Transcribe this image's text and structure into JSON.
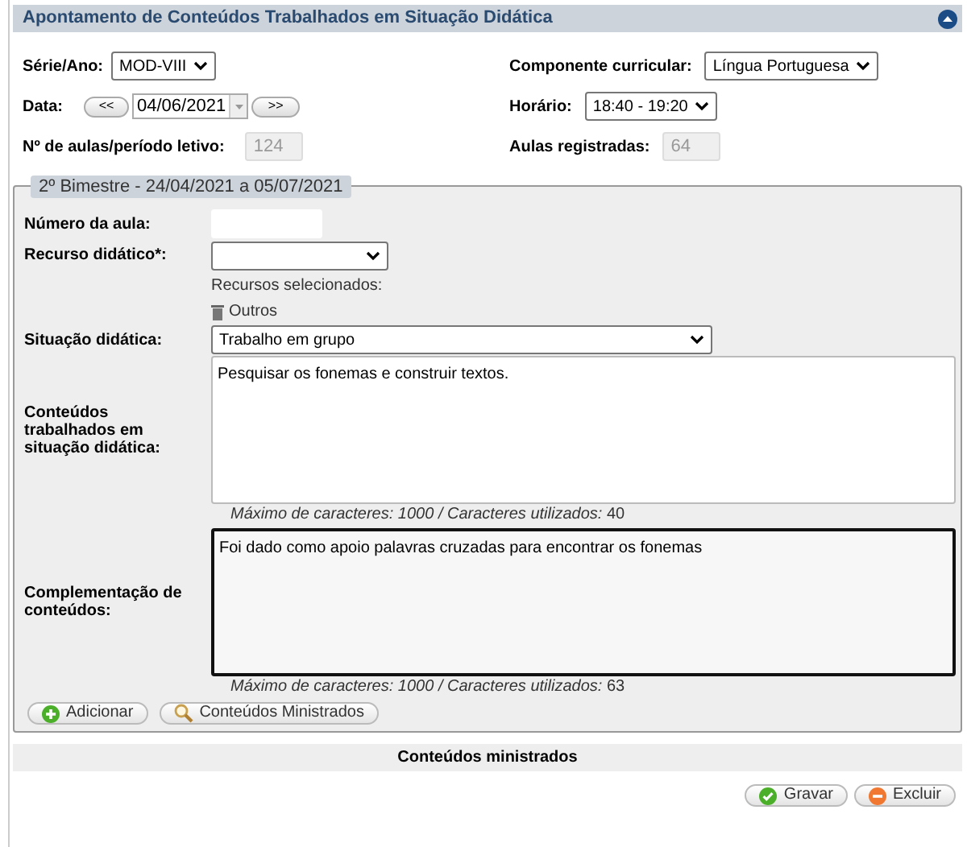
{
  "panel": {
    "title": "Apontamento de Conteúdos Trabalhados em Situação Didática",
    "expanded": true
  },
  "top_rows": [
    {
      "left": {
        "kind": "select",
        "label": "Série/Ano:",
        "value": "MOD-VIII"
      },
      "right": {
        "kind": "select",
        "label": "Componente curricular:",
        "value": "Língua Portuguesa"
      }
    },
    {
      "left": {
        "kind": "date",
        "label": "Data:",
        "prev": "<<",
        "value": "04/06/2021",
        "next": ">>"
      },
      "right": {
        "kind": "select",
        "label": "Horário:",
        "value": "18:40 - 19:20"
      }
    },
    {
      "left": {
        "kind": "readonly",
        "label": "Nº de aulas/período letivo:",
        "value": "124",
        "disabled": true
      },
      "right": {
        "kind": "readonly",
        "label": "Aulas registradas:",
        "value": "64",
        "disabled": true
      }
    }
  ],
  "fieldset": {
    "legend": "2º Bimestre - 24/04/2021 a 05/07/2021",
    "lesson_number": {
      "label": "Número da aula:"
    },
    "resource": {
      "label": "Recurso didático*:",
      "selected_label": "Recursos selecionados:",
      "selected_items": [
        "Outros"
      ]
    },
    "situation": {
      "label": "Situação didática:",
      "value": "Trabalho em grupo"
    },
    "textareas": [
      {
        "label": "Conteúdos trabalhados em situação didática:",
        "value": "Pesquisar os fonemas e construir textos.",
        "focused": false,
        "counter": "*Máximo de caracteres: 1000 / Caracteres utilizados:* 40"
      },
      {
        "label": "Complementação de conteúdos:",
        "value": "Foi dado como apoio palavras cruzadas para encontrar os fonemas",
        "focused": true,
        "counter": "*Máximo de caracteres: 1000 / Caracteres utilizados:* 63"
      }
    ],
    "buttons": [
      {
        "kind": "add",
        "label": "Adicionar"
      },
      {
        "kind": "search",
        "label": "Conteúdos Ministrados"
      }
    ]
  },
  "section_title": "Conteúdos ministrados",
  "actions": [
    {
      "kind": "save",
      "label": "Gravar"
    },
    {
      "kind": "delete",
      "label": "Excluir"
    }
  ]
}
